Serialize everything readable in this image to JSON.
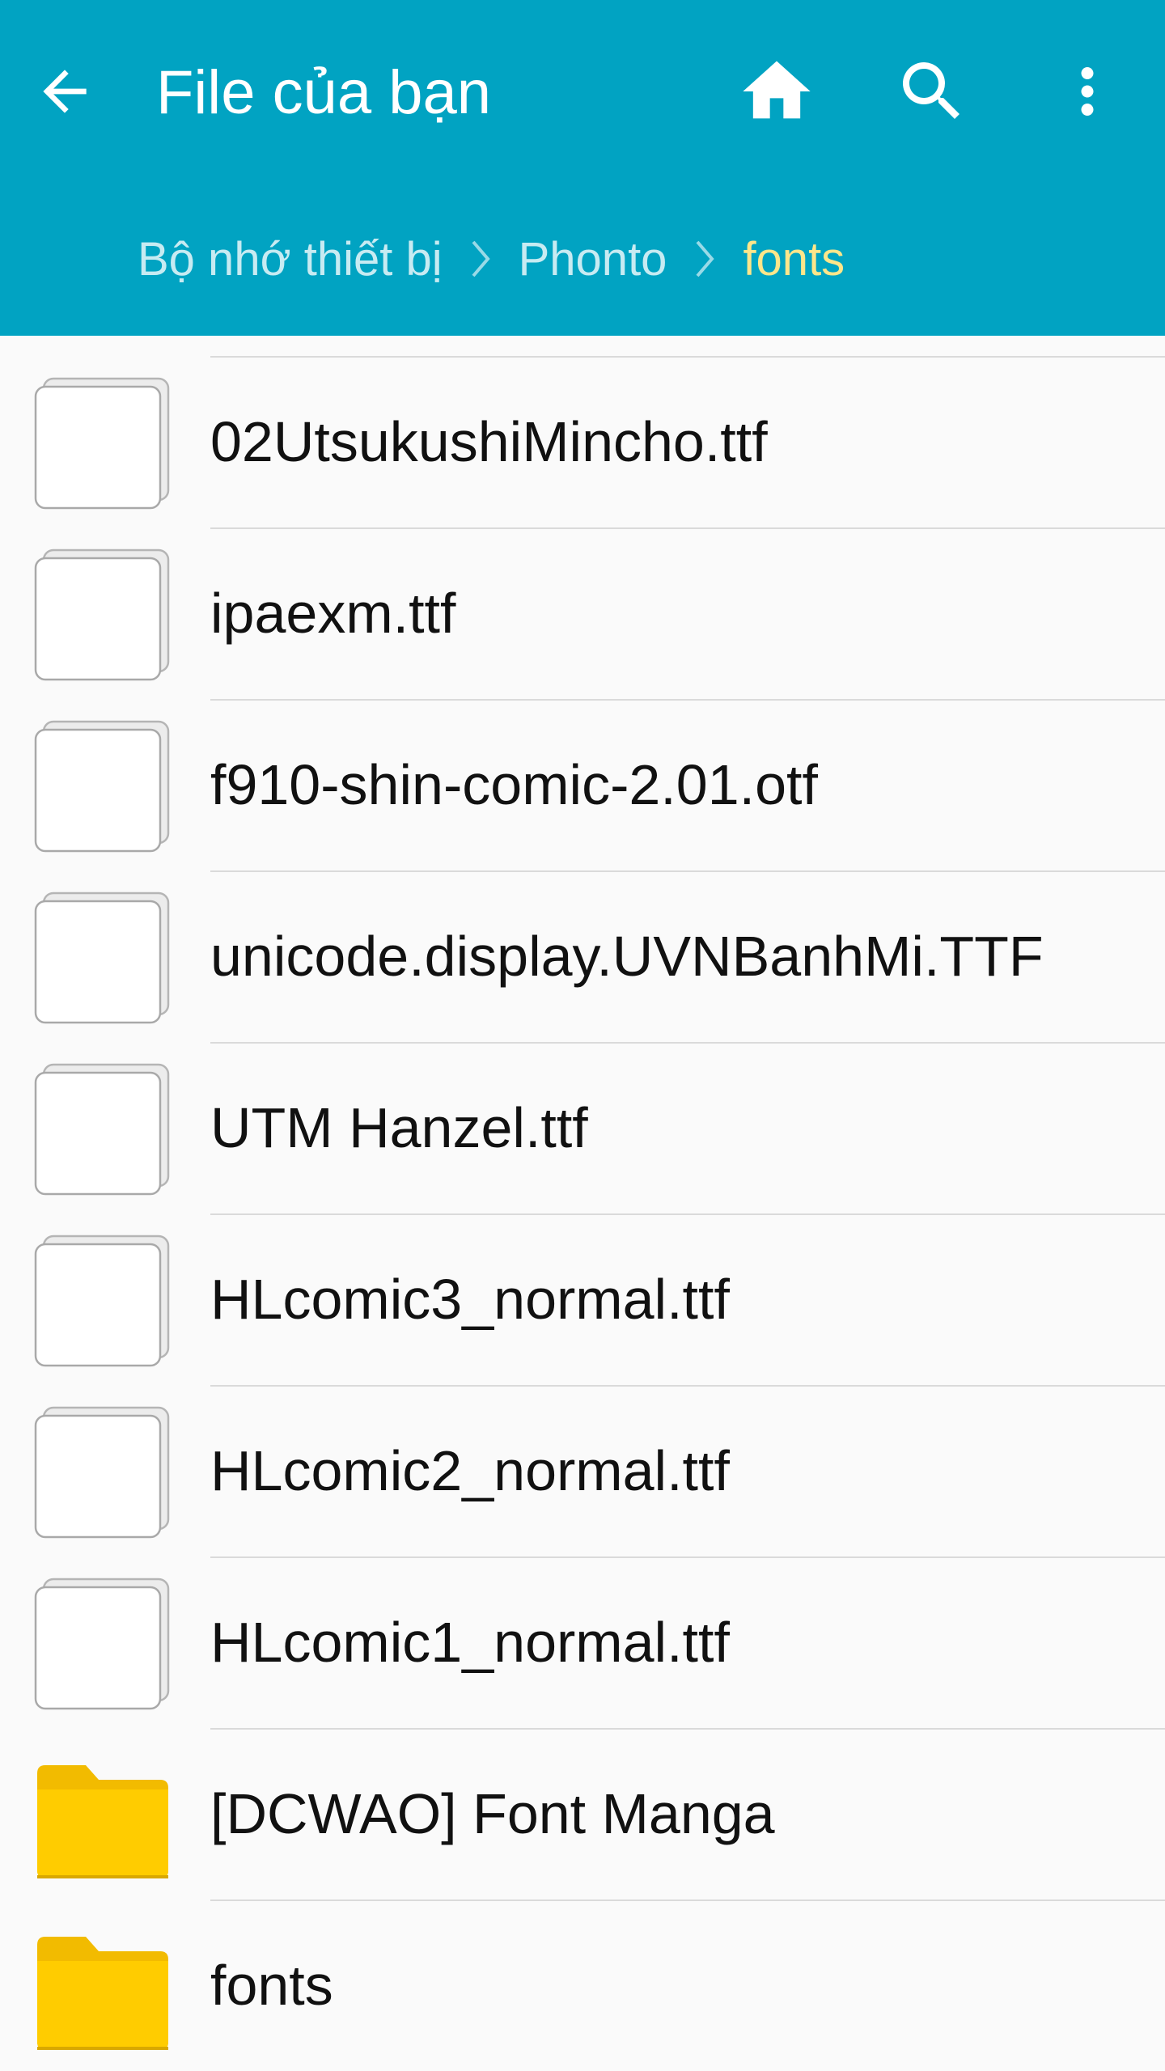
{
  "header": {
    "title": "File của bạn",
    "back_icon": "arrow-left-icon",
    "home_icon": "home-icon",
    "search_icon": "search-icon",
    "more_icon": "more-vertical-icon",
    "background_color": "#01a3c2"
  },
  "breadcrumb": {
    "items": [
      "Bộ nhớ thiết bị",
      "Phonto",
      "fonts"
    ],
    "current_color": "#fde68a"
  },
  "files": [
    {
      "name": "02UtsukushiMincho.ttf",
      "type": "file"
    },
    {
      "name": "ipaexm.ttf",
      "type": "file"
    },
    {
      "name": "f910-shin-comic-2.01.otf",
      "type": "file"
    },
    {
      "name": "unicode.display.UVNBanhMi.TTF",
      "type": "file"
    },
    {
      "name": "UTM Hanzel.ttf",
      "type": "file"
    },
    {
      "name": "HLcomic3_normal.ttf",
      "type": "file"
    },
    {
      "name": "HLcomic2_normal.ttf",
      "type": "file"
    },
    {
      "name": "HLcomic1_normal.ttf",
      "type": "file"
    },
    {
      "name": "[DCWAO] Font Manga",
      "type": "folder"
    },
    {
      "name": "fonts",
      "type": "folder"
    }
  ],
  "colors": {
    "folder": "#ffcc00",
    "folder_tab": "#f2bb00"
  }
}
